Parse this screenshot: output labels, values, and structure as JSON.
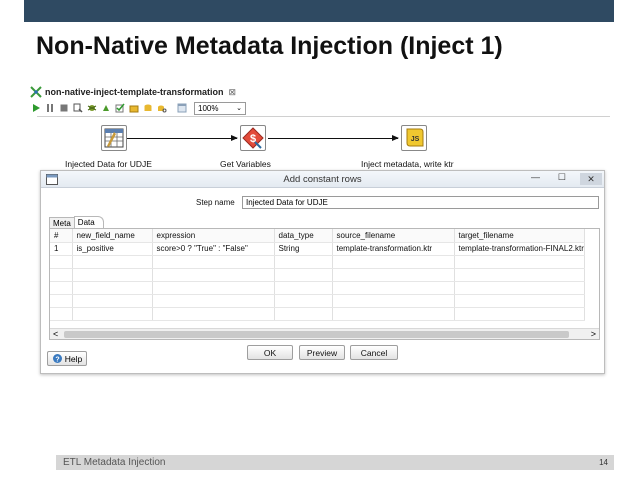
{
  "slide": {
    "title": "Non-Native Metadata Injection (Inject 1)",
    "footer_text": "ETL Metadata Injection",
    "page_number": "14"
  },
  "editor": {
    "tab_title": "non-native-inject-template-transformation",
    "tab_close": "⊠",
    "zoom": "100%"
  },
  "canvas": {
    "steps": [
      {
        "label": "Injected Data for UDJE",
        "icon": "table-icon"
      },
      {
        "label": "Get Variables",
        "icon": "dollar-icon"
      },
      {
        "label": "Inject metadata, write ktr",
        "icon": "script-icon"
      }
    ]
  },
  "dialog": {
    "title": "Add constant rows",
    "minimize": "—",
    "maximize": "☐",
    "close": "✕",
    "step_name_label": "Step name",
    "step_name_value": "Injected Data for UDJE",
    "tabs": [
      {
        "label": "Meta",
        "active": false
      },
      {
        "label": "Data",
        "active": true
      }
    ],
    "grid": {
      "columns": [
        "#",
        "new_field_name",
        "expression",
        "data_type",
        "source_filename",
        "target_filename"
      ],
      "rows": [
        [
          "1",
          "is_positive",
          "score>0 ? \"True\" : \"False\"",
          "String",
          "template-transformation.ktr",
          "template-transformation-FINAL2.ktr"
        ]
      ]
    },
    "scroll_left": "<",
    "scroll_right": ">",
    "buttons": {
      "ok": "OK",
      "preview": "Preview",
      "cancel": "Cancel",
      "help": "Help"
    }
  },
  "colors": {
    "topbar": "#2f4a62",
    "dialog_titlebar": "#e4eaf1",
    "footer": "#d6d6d6"
  }
}
